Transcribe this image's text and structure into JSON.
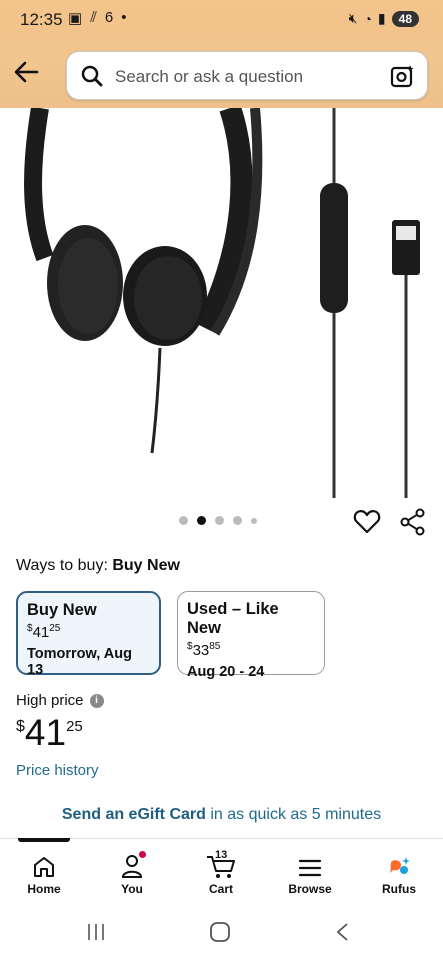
{
  "status_bar": {
    "time": "12:35",
    "battery": "48"
  },
  "search": {
    "placeholder": "Search or ask a question"
  },
  "ways_to_buy": {
    "label": "Ways to buy:",
    "selected": "Buy New"
  },
  "options": [
    {
      "title": "Buy New",
      "currency": "$",
      "dollars": "41",
      "cents": "25",
      "delivery": "Tomorrow, Aug 13",
      "selected": true
    },
    {
      "title": "Used – Like New",
      "currency": "$",
      "dollars": "33",
      "cents": "85",
      "delivery": "Aug 20 - 24",
      "selected": false
    }
  ],
  "price": {
    "label": "High price",
    "currency": "$",
    "dollars": "41",
    "cents": "25",
    "history_link": "Price history"
  },
  "egift": {
    "link": "Send an eGift Card",
    "rest": " in as quick as 5 minutes"
  },
  "image_dots": {
    "count": 5,
    "active": 1
  },
  "bottom_nav": {
    "items": [
      {
        "label": "Home",
        "icon": "home-icon"
      },
      {
        "label": "You",
        "icon": "person-icon"
      },
      {
        "label": "Cart",
        "icon": "cart-icon",
        "badge": "13"
      },
      {
        "label": "Browse",
        "icon": "menu-icon"
      },
      {
        "label": "Rufus",
        "icon": "rufus-icon"
      }
    ]
  },
  "colors": {
    "header": "#f3c48b",
    "link": "#1f6b8f",
    "selected_border": "#2f5f87"
  }
}
